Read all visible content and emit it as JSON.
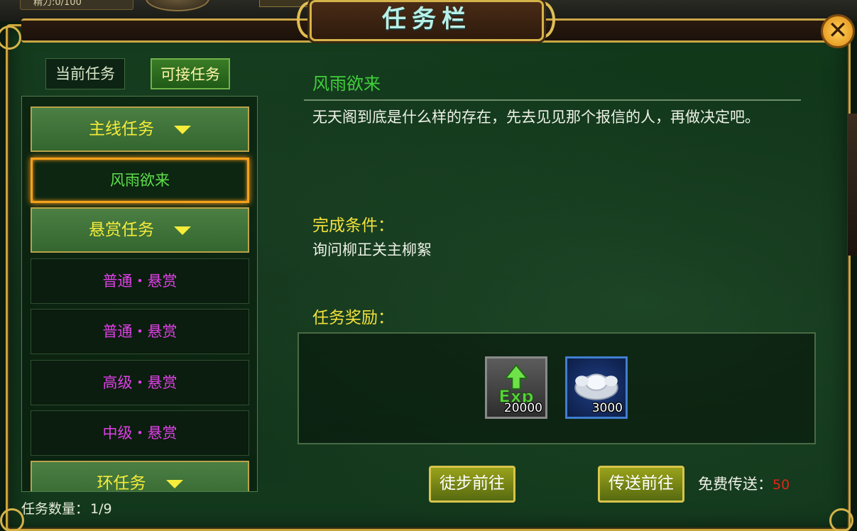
{
  "hud": {
    "stamina_label": "精力:0/100"
  },
  "window": {
    "title": "任务栏",
    "close_icon": "close-x-icon"
  },
  "tabs": [
    {
      "label": "当前任务",
      "active": false
    },
    {
      "label": "可接任务",
      "active": true
    }
  ],
  "quest_list": {
    "categories": {
      "main": "主线任务",
      "bounty": "悬赏任务",
      "ring": "环任务"
    },
    "main_items": [
      {
        "label": "风雨欲来",
        "selected": true
      }
    ],
    "bounty_items": [
      {
        "label": "普通・悬赏"
      },
      {
        "label": "普通・悬赏"
      },
      {
        "label": "高级・悬赏"
      },
      {
        "label": "中级・悬赏"
      }
    ]
  },
  "quest_count": {
    "label": "任务数量：",
    "value": "1/9"
  },
  "detail": {
    "title": "风雨欲来",
    "description": "无天阁到底是什么样的存在，先去见见那个报信的人，再做决定吧。",
    "condition_heading": "完成条件：",
    "condition_text": "询问柳正关主柳絮",
    "reward_heading": "任务奖励：",
    "rewards": [
      {
        "icon": "exp-icon",
        "count": "20000"
      },
      {
        "icon": "silver-ingot-icon",
        "count": "3000"
      }
    ]
  },
  "actions": {
    "walk_label": "徒步前往",
    "teleport_label": "传送前往",
    "free_teleport_label": "免费传送：",
    "free_teleport_count": "50"
  },
  "colors": {
    "frame_gold": "#c9a53a",
    "panel_green": "#123a1b",
    "title_cyan": "#b7f0e8",
    "category_yellow": "#f6ec3a",
    "quest_green": "#5ee04a",
    "bounty_magenta": "#e040e8",
    "heading_yellow": "#f2e13c",
    "count_red": "#e0261b"
  }
}
